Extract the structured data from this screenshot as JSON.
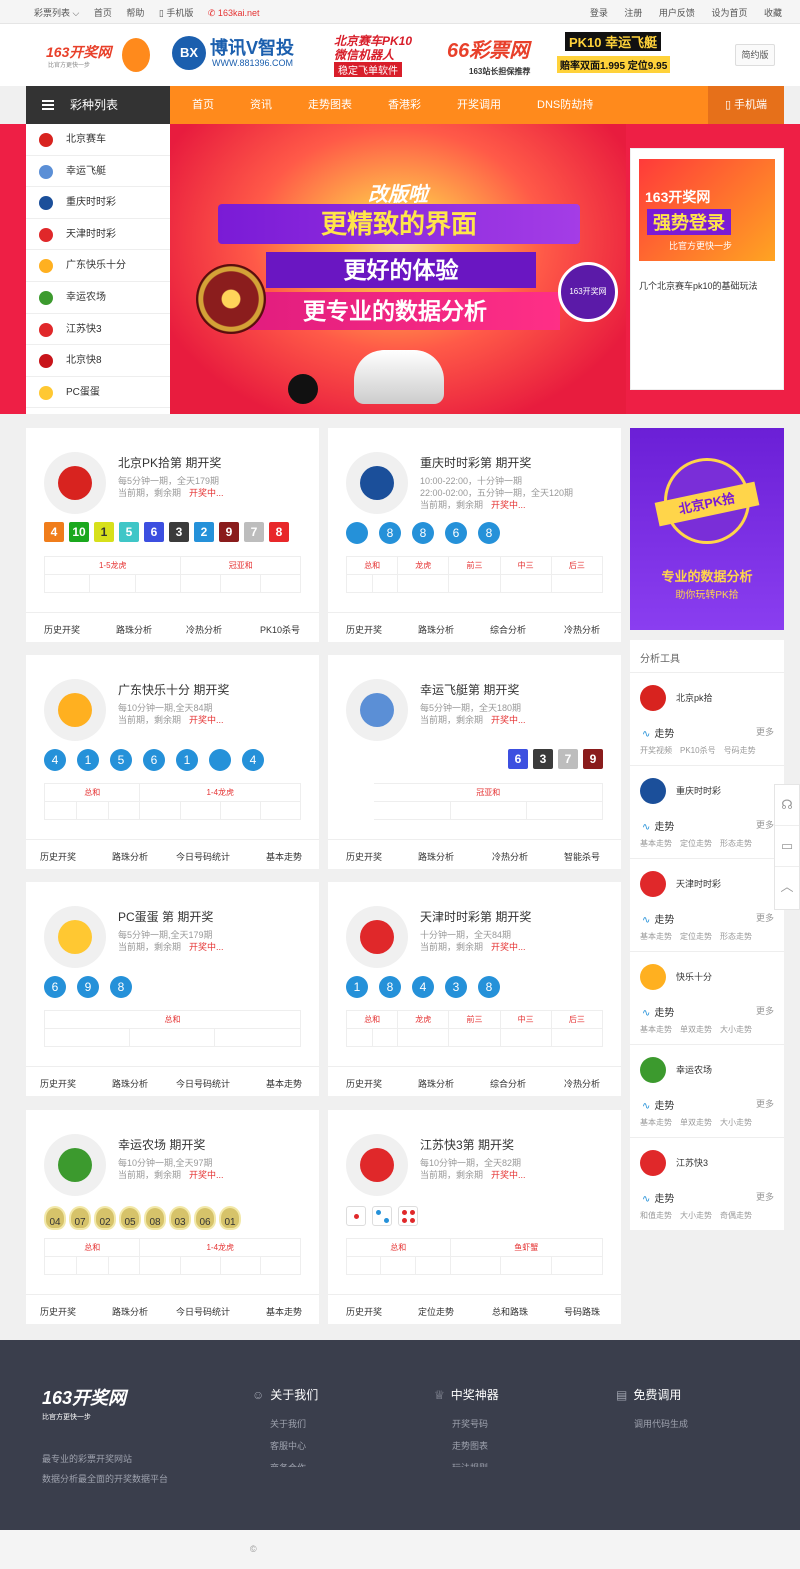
{
  "topbar": {
    "left": [
      "彩票列表 ⌵",
      "首页",
      "帮助",
      "▯ 手机版"
    ],
    "domain": "✆ 163kai.net",
    "right": [
      "登录",
      "注册",
      "用户反馈",
      "设为首页",
      "收藏"
    ]
  },
  "header": {
    "logo_text": "163开奖网",
    "logo_slogan": "比官方更快一步",
    "ad1_title": "博讯V智投",
    "ad1_url": "WWW.881396.COM",
    "ad1_line1": "北京赛车PK10",
    "ad1_line2": "微信机器人",
    "ad1_line3": "稳定飞单软件",
    "ad2_title": "66彩票网",
    "ad2_sub": "163站长担保推荐",
    "ad2_pk": "PK10 幸运飞艇",
    "ad2_odds": "赔率双面1.995 定位9.95",
    "simple_btn": "简约版"
  },
  "nav": {
    "category": "彩种列表",
    "items": [
      "首页",
      "资讯",
      "走势图表",
      "香港彩",
      "开奖调用",
      "DNS防劫持"
    ],
    "mobile": "▯ 手机端"
  },
  "sidebar": [
    "北京赛车",
    "幸运飞艇",
    "重庆时时彩",
    "天津时时彩",
    "广东快乐十分",
    "幸运农场",
    "江苏快3",
    "北京快8",
    "PC蛋蛋"
  ],
  "hero": {
    "line0": "改版啦",
    "line1": "更精致的界面",
    "line2": "更好的体验",
    "line3": "更专业的数据分析",
    "badge": "163开奖网"
  },
  "news": {
    "img_line1": "163开奖网",
    "img_line2": "强势登录",
    "img_line3": "比官方更快一步",
    "text": "几个北京赛车pk10的基础玩法"
  },
  "cards": [
    {
      "title": "北京PK拾第  期开奖",
      "i1": "每5分钟一期，全天179期",
      "i2": "当前期，剩余期",
      "open": "开奖中...",
      "balls": [
        "4",
        "10",
        "1",
        "5",
        "6",
        "3",
        "2",
        "9",
        "7",
        "8"
      ],
      "table_head": [
        "1-5龙虎",
        "冠亚和"
      ],
      "links": [
        "历史开奖",
        "路珠分析",
        "冷热分析",
        "PK10杀号"
      ]
    },
    {
      "title": "重庆时时彩第  期开奖",
      "i1": "10:00-22:00，十分钟一期",
      "i1b": "22:00-02:00，五分钟一期，全天120期",
      "i2": "当前期，剩余期",
      "open": "开奖中...",
      "balls": [
        "",
        "8",
        "8",
        "6",
        "8"
      ],
      "table_head": [
        "总和",
        "龙虎",
        "前三",
        "中三",
        "后三"
      ],
      "links": [
        "历史开奖",
        "路珠分析",
        "综合分析",
        "冷热分析"
      ]
    },
    {
      "title": "广东快乐十分  期开奖",
      "i1": "每10分钟一期,全天84期",
      "i2": "当前期，剩余期",
      "open": "开奖中...",
      "balls": [
        "4",
        "1",
        "5",
        "6",
        "1",
        "",
        "4",
        ""
      ],
      "table_head": [
        "总和",
        "1-4龙虎"
      ],
      "links": [
        "历史开奖",
        "路珠分析",
        "今日号码统计",
        "基本走势"
      ]
    },
    {
      "title": "幸运飞艇第  期开奖",
      "i1": "每5分钟一期，全天180期",
      "i2": "当前期，剩余期",
      "open": "开奖中...",
      "balls": [
        "6",
        "3",
        "7",
        "9"
      ],
      "table_head": [
        "冠亚和"
      ],
      "links": [
        "历史开奖",
        "路珠分析",
        "冷热分析",
        "智能杀号"
      ]
    },
    {
      "title": "PC蛋蛋 第  期开奖",
      "i1": "每5分钟一期,全天179期",
      "i2": "当前期，剩余期",
      "open": "开奖中...",
      "balls": [
        "6",
        "9",
        "8"
      ],
      "table_head": [
        "总和"
      ],
      "links": [
        "历史开奖",
        "路珠分析",
        "今日号码统计",
        "基本走势"
      ]
    },
    {
      "title": "天津时时彩第  期开奖",
      "i1": "十分钟一期，全天84期",
      "i2": "当前期，剩余期",
      "open": "开奖中...",
      "balls": [
        "1",
        "8",
        "4",
        "3",
        "8"
      ],
      "table_head": [
        "总和",
        "龙虎",
        "前三",
        "中三",
        "后三"
      ],
      "links": [
        "历史开奖",
        "路珠分析",
        "综合分析",
        "冷热分析"
      ]
    },
    {
      "title": "幸运农场  期开奖",
      "i1": "每10分钟一期,全天97期",
      "i2": "当前期，剩余期",
      "open": "开奖中...",
      "balls": [
        "04",
        "07",
        "02",
        "05",
        "08",
        "03",
        "06",
        "01"
      ],
      "table_head": [
        "总和",
        "1-4龙虎"
      ],
      "links": [
        "历史开奖",
        "路珠分析",
        "今日号码统计",
        "基本走势"
      ]
    },
    {
      "title": "江苏快3第  期开奖",
      "i1": "每10分钟一期，全天82期",
      "i2": "当前期，剩余期",
      "open": "开奖中...",
      "balls": [
        "1",
        "2",
        "4"
      ],
      "table_head": [
        "总和",
        "鱼虾蟹"
      ],
      "links": [
        "历史开奖",
        "定位走势",
        "总和路珠",
        "号码路珠"
      ]
    }
  ],
  "ad_right": {
    "title": "北京PK拾",
    "line1": "专业的数据分析",
    "line2": "助你玩转PK拾"
  },
  "tools": {
    "header": "分析工具",
    "items": [
      {
        "name": "北京pk拾",
        "trend": "走势",
        "more": "更多",
        "subs": [
          "开奖视频",
          "PK10杀号",
          "号码走势"
        ]
      },
      {
        "name": "重庆时时彩",
        "trend": "走势",
        "more": "更多",
        "subs": [
          "基本走势",
          "定位走势",
          "形态走势"
        ]
      },
      {
        "name": "天津时时彩",
        "trend": "走势",
        "more": "更多",
        "subs": [
          "基本走势",
          "定位走势",
          "形态走势"
        ]
      },
      {
        "name": "快乐十分",
        "trend": "走势",
        "more": "更多",
        "subs": [
          "基本走势",
          "单双走势",
          "大小走势"
        ]
      },
      {
        "name": "幸运农场",
        "trend": "走势",
        "more": "更多",
        "subs": [
          "基本走势",
          "单双走势",
          "大小走势"
        ]
      },
      {
        "name": "江苏快3",
        "trend": "走势",
        "more": "更多",
        "subs": [
          "和值走势",
          "大小走势",
          "奇偶走势"
        ]
      }
    ]
  },
  "footer": {
    "logo": "163开奖网",
    "slogan": "比官方更快一步",
    "desc1": "最专业的彩票开奖网站",
    "desc2": "数据分析最全面的开奖数据平台",
    "col1": {
      "title": "关于我们",
      "links": [
        "关于我们",
        "客服中心",
        "商务合作"
      ]
    },
    "col2": {
      "title": "中奖神器",
      "links": [
        "开奖号码",
        "走势图表",
        "玩法规则"
      ]
    },
    "col3": {
      "title": "免费调用",
      "links": [
        "调用代码生成"
      ]
    }
  },
  "copyright": "©",
  "colors": {
    "accent": "#ff8a1c",
    "nav_dark": "#333333",
    "ball_blue": "#2591d9",
    "alert_red": "#e53333",
    "footer_bg": "#3a3e4c"
  }
}
